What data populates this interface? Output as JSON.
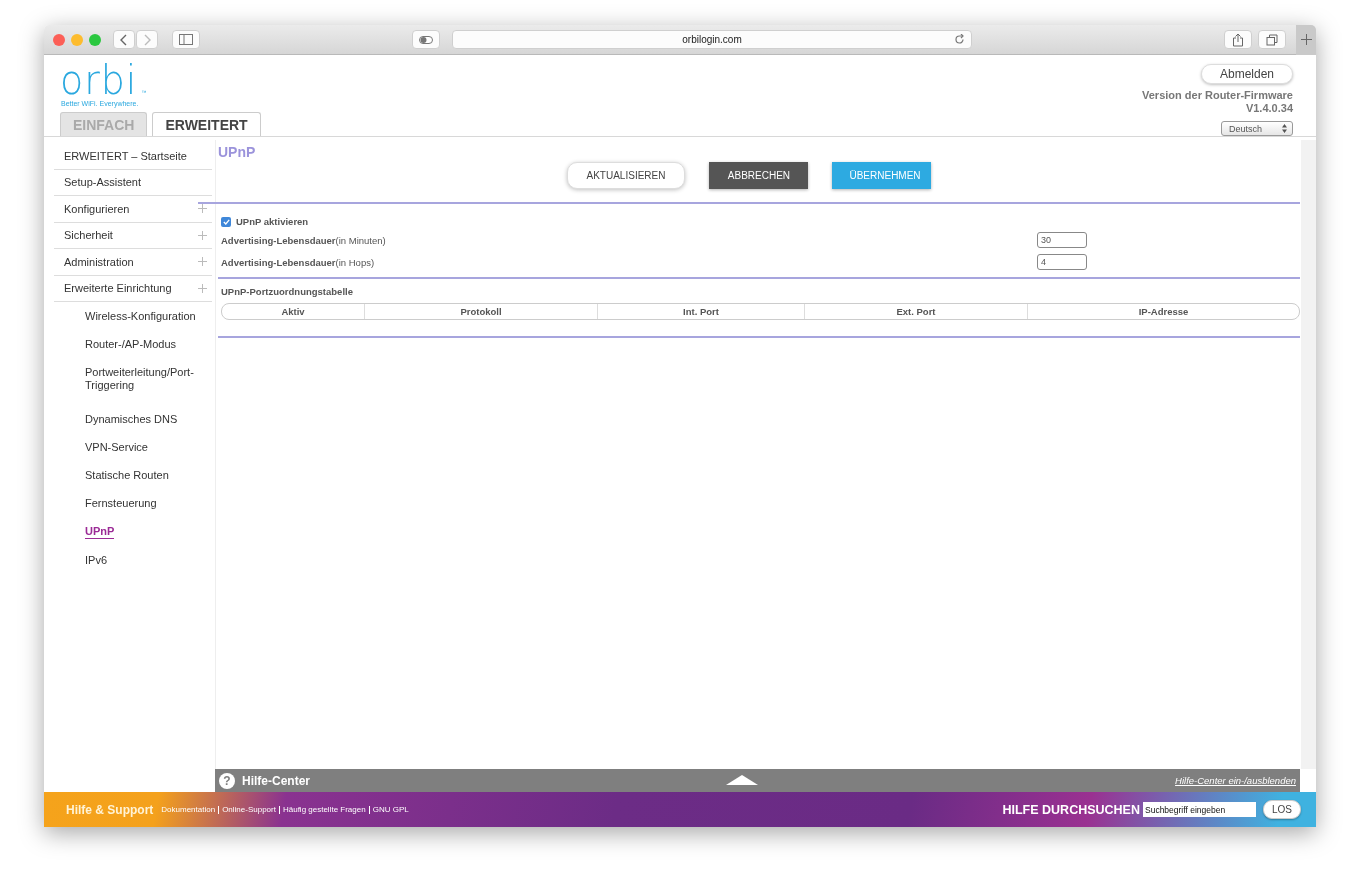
{
  "browser": {
    "address": "orbilogin.com"
  },
  "header": {
    "logo": "orbi",
    "trademark": "™",
    "tagline": "Better WiFi. Everywhere.",
    "tabs": [
      {
        "label": "EINFACH",
        "selected": false
      },
      {
        "label": "ERWEITERT",
        "selected": true
      }
    ],
    "logout": "Abmelden",
    "firmware_label": "Version der Router-Firmware",
    "firmware_version": "V1.4.0.34",
    "language": "Deutsch"
  },
  "sidebar": {
    "items": [
      {
        "label": "ERWEITERT – Startseite",
        "expandable": false
      },
      {
        "label": "Setup-Assistent",
        "expandable": false
      },
      {
        "label": "Konfigurieren",
        "expandable": true
      },
      {
        "label": "Sicherheit",
        "expandable": true
      },
      {
        "label": "Administration",
        "expandable": true
      },
      {
        "label": "Erweiterte Einrichtung",
        "expandable": true,
        "children": [
          {
            "label": "Wireless-Konfiguration",
            "selected": false
          },
          {
            "label": "Router-/AP-Modus",
            "selected": false
          },
          {
            "label": "Portweiterleitung/Port-Triggering",
            "selected": false
          },
          {
            "label": "Dynamisches DNS",
            "selected": false
          },
          {
            "label": "VPN-Service",
            "selected": false
          },
          {
            "label": "Statische Routen",
            "selected": false
          },
          {
            "label": "Fernsteuerung",
            "selected": false
          },
          {
            "label": "UPnP",
            "selected": true
          },
          {
            "label": "IPv6",
            "selected": false
          }
        ]
      }
    ]
  },
  "main": {
    "title": "UPnP",
    "buttons": [
      {
        "label": "AKTUALISIEREN",
        "kind": "outline"
      },
      {
        "label": "ABBRECHEN",
        "kind": "dark"
      },
      {
        "label": "ÜBERNEHMEN",
        "kind": "primary"
      }
    ],
    "enable": {
      "label": "UPnP aktivieren",
      "checked": true
    },
    "fields": [
      {
        "label": "Advertising-Lebensdauer",
        "unit": "(in Minuten)",
        "value": "30"
      },
      {
        "label": "Advertising-Lebensdauer",
        "unit": "(in Hops)",
        "value": "4"
      }
    ],
    "table": {
      "title": "UPnP-Portzuordnungstabelle",
      "columns": [
        "Aktiv",
        "Protokoll",
        "Int. Port",
        "Ext. Port",
        "IP-Adresse"
      ]
    }
  },
  "help_bar": {
    "icon": "?",
    "title": "Hilfe-Center",
    "toggle_link": "Hilfe-Center ein-/ausblenden"
  },
  "footer": {
    "title": "Hilfe & Support",
    "links": [
      "Dokumentation",
      "Online-Support",
      "Häufig gestellte Fragen",
      "GNU GPL"
    ],
    "search_label": "HILFE DURCHSUCHEN",
    "search_placeholder": "Suchbegriff eingeben",
    "search_button": "LOS"
  }
}
